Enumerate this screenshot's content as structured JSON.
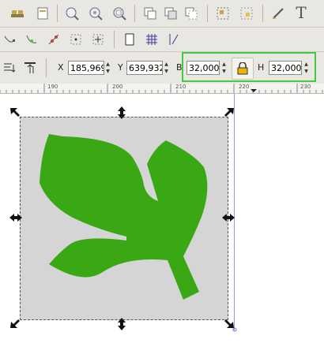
{
  "toolbar_top": {
    "icons": [
      "print-icon",
      "import-icon",
      "zoom-selection-icon",
      "zoom-drawing-icon",
      "zoom-page-icon",
      "duplicate-icon",
      "clone-icon",
      "unlink-clone-icon",
      "group-icon",
      "ungroup-icon",
      "xml-editor-icon",
      "text-tool-icon"
    ],
    "text_tool_glyph": "T"
  },
  "toolbar_snap": {
    "icons": [
      "snap-nodes-icon",
      "snap-paths-icon",
      "snap-intersections-icon",
      "snap-center-icon",
      "snap-rotation-center-icon",
      "snap-page-icon",
      "grid-icon",
      "guides-icon"
    ]
  },
  "toolbar_controls": {
    "x_label": "X",
    "x_value": "185,969",
    "y_label": "Y",
    "y_value": "639,932",
    "w_label": "B",
    "w_value": "32,000",
    "h_label": "H",
    "h_value": "32,000"
  },
  "ruler": {
    "labels": [
      "190",
      "200",
      "210",
      "220",
      "230"
    ]
  },
  "colors": {
    "highlight": "#47c845",
    "shape_fill": "#3aa815",
    "selection_bg": "#d4d5d4"
  }
}
